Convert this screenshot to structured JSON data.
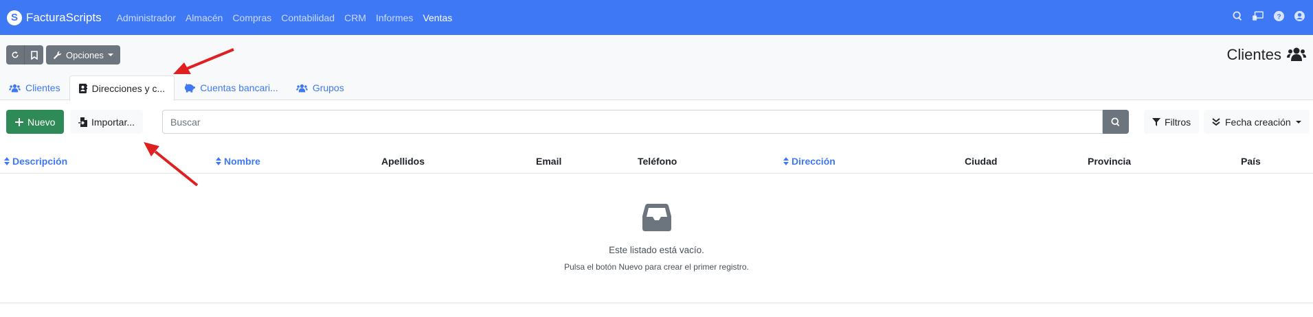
{
  "navbar": {
    "brand": "FacturaScripts",
    "brand_logo": "S",
    "menu": [
      "Administrador",
      "Almacén",
      "Compras",
      "Contabilidad",
      "CRM",
      "Informes",
      "Ventas"
    ],
    "active_menu": "Ventas",
    "icons": [
      "search-icon",
      "cast-icon",
      "help-icon",
      "user-icon"
    ],
    "bg_color": "#3f78f5"
  },
  "toolbar": {
    "options_label": "Opciones",
    "page_title": "Clientes"
  },
  "tabs": [
    {
      "label": "Clientes",
      "icon": "users-icon",
      "active": false
    },
    {
      "label": "Direcciones y c...",
      "icon": "address-book-icon",
      "active": true
    },
    {
      "label": "Cuentas bancari...",
      "icon": "piggy-bank-icon",
      "active": false
    },
    {
      "label": "Grupos",
      "icon": "users-icon",
      "active": false
    }
  ],
  "actions": {
    "new_label": "Nuevo",
    "import_label": "Importar...",
    "search_placeholder": "Buscar",
    "filters_label": "Filtros",
    "sort_label": "Fecha creación"
  },
  "table": {
    "columns": [
      {
        "label": "Descripción",
        "sortable": true
      },
      {
        "label": "Nombre",
        "sortable": true
      },
      {
        "label": "Apellidos",
        "sortable": false
      },
      {
        "label": "Email",
        "sortable": false
      },
      {
        "label": "Teléfono",
        "sortable": false
      },
      {
        "label": "Dirección",
        "sortable": true
      },
      {
        "label": "Ciudad",
        "sortable": false
      },
      {
        "label": "Provincia",
        "sortable": false
      },
      {
        "label": "País",
        "sortable": false
      }
    ],
    "rows": []
  },
  "empty_state": {
    "title": "Este listado está vacío.",
    "subtitle": "Pulsa el botón Nuevo para crear el primer registro.",
    "icon": "inbox-icon"
  },
  "colors": {
    "accent": "#3f78f5",
    "success": "#2e8b57",
    "secondary": "#6c757d",
    "annotation_arrow": "#e02020"
  }
}
